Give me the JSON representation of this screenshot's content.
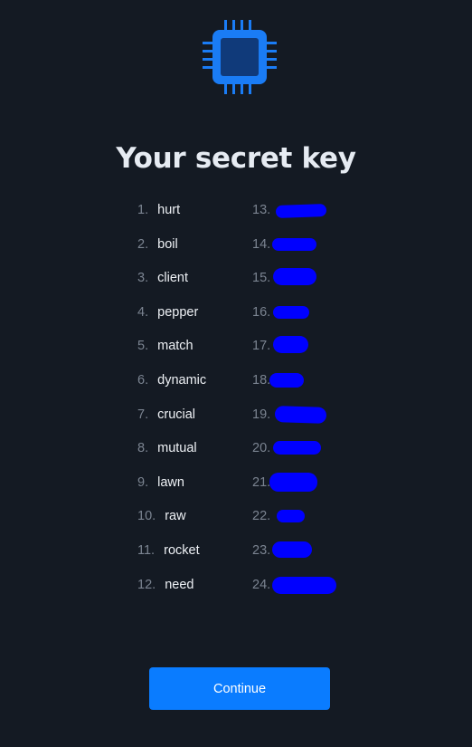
{
  "logo": {
    "icon": "chip-icon",
    "accent": "#1a7cf5",
    "inner": "#103a7a"
  },
  "title": "Your secret key",
  "words": [
    {
      "num": "1.",
      "word": "hurt"
    },
    {
      "num": "2.",
      "word": "boil"
    },
    {
      "num": "3.",
      "word": "client"
    },
    {
      "num": "4.",
      "word": "pepper"
    },
    {
      "num": "5.",
      "word": "match"
    },
    {
      "num": "6.",
      "word": "dynamic"
    },
    {
      "num": "7.",
      "word": "crucial"
    },
    {
      "num": "8.",
      "word": "mutual"
    },
    {
      "num": "9.",
      "word": "lawn"
    },
    {
      "num": "10.",
      "word": "raw"
    },
    {
      "num": "11.",
      "word": "rocket"
    },
    {
      "num": "12.",
      "word": "need"
    },
    {
      "num": "13.",
      "word": ""
    },
    {
      "num": "14.",
      "word": ""
    },
    {
      "num": "15.",
      "word": ""
    },
    {
      "num": "16.",
      "word": ""
    },
    {
      "num": "17.",
      "word": ""
    },
    {
      "num": "18.",
      "word": ""
    },
    {
      "num": "19.",
      "word": ""
    },
    {
      "num": "20.",
      "word": ""
    },
    {
      "num": "21.",
      "word": ""
    },
    {
      "num": "22.",
      "word": ""
    },
    {
      "num": "23.",
      "word": ""
    },
    {
      "num": "24.",
      "word": ""
    }
  ],
  "continue_label": "Continue",
  "colors": {
    "background": "#141a23",
    "button": "#0a7cff",
    "redaction": "#0000ff"
  }
}
